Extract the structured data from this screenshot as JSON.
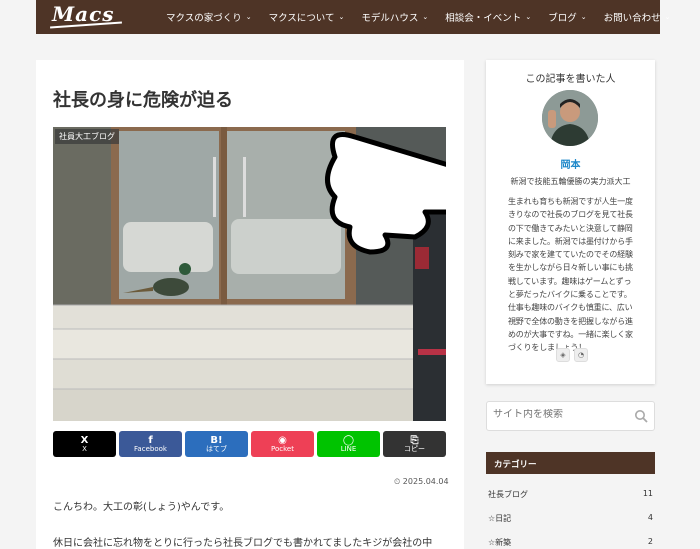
{
  "header": {
    "logo": "Macs",
    "nav": [
      {
        "label": "マクスの家づくり"
      },
      {
        "label": "マクスについて"
      },
      {
        "label": "モデルハウス"
      },
      {
        "label": "相談会・イベント"
      },
      {
        "label": "ブログ"
      },
      {
        "label": "お問い合わせ"
      }
    ]
  },
  "post": {
    "title": "社長の身に危険が迫る",
    "category_label": "社員大工ブログ",
    "date": "2025.04.04",
    "paragraph1": "こんちわ。大工の彰(しょう)やんです。",
    "paragraph2": "休日に会社に忘れ物をとりに行ったら社長ブログでも書かれてましたキジが会社の中"
  },
  "share": [
    {
      "icon": "X",
      "label": "X",
      "color": "#000000"
    },
    {
      "icon": "f",
      "label": "Facebook",
      "color": "#3b5998"
    },
    {
      "icon": "B!",
      "label": "はてブ",
      "color": "#2c6ebd"
    },
    {
      "icon": "◉",
      "label": "Pocket",
      "color": "#ee4056"
    },
    {
      "icon": "◯",
      "label": "LINE",
      "color": "#00c300"
    },
    {
      "icon": "⎘",
      "label": "コピー",
      "color": "#333333"
    }
  ],
  "sidebar": {
    "author_heading": "この記事を書いた人",
    "author_name": "岡本",
    "author_role": "新潟で技能五輪優勝の実力派大工",
    "author_bio": "生まれも育ちも新潟ですが人生一度きりなので社長のブログを見て社長の下で働きてみたいと決意して静岡に来ました。新潟では墨付けから手刻みで家を建てていたのでその経験を生かしながら日々新しい事にも挑戦しています。趣味はゲームとずっと夢だったバイクに乗ることです。仕事も趣味のバイクも慎重に、広い視野で全体の動きを把握しながら進めのが大事ですね。一緒に楽しく家づくりをしましょう！",
    "search_placeholder": "サイト内を検索",
    "category_heading": "カテゴリー",
    "categories": [
      {
        "label": "社長ブログ",
        "count": "11"
      },
      {
        "label": "☆日記",
        "count": "4"
      },
      {
        "label": "☆新築",
        "count": "2"
      }
    ]
  }
}
